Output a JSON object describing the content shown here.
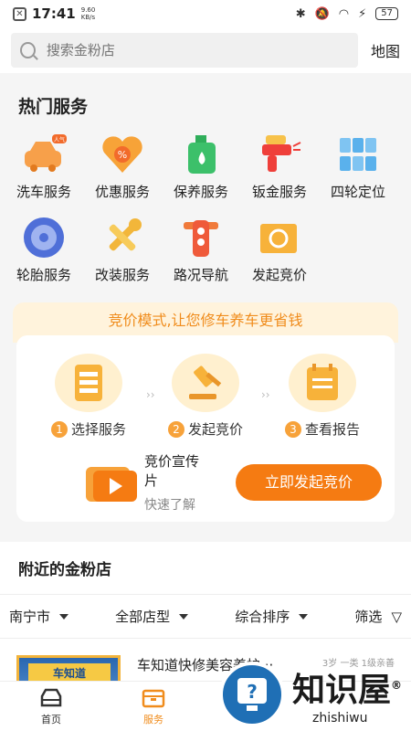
{
  "status_bar": {
    "time": "17:41",
    "net_speed": "9.60",
    "net_unit": "KB/s",
    "battery": "57"
  },
  "search": {
    "placeholder": "搜索金粉店",
    "map_label": "地图"
  },
  "hot_services": {
    "title": "热门服务",
    "items": [
      {
        "label": "洗车服务",
        "icon": "car-wash-icon",
        "badge": "人气"
      },
      {
        "label": "优惠服务",
        "icon": "discount-heart-icon"
      },
      {
        "label": "保养服务",
        "icon": "oil-can-icon"
      },
      {
        "label": "钣金服务",
        "icon": "spray-gun-icon"
      },
      {
        "label": "四轮定位",
        "icon": "grid-blocks-icon"
      },
      {
        "label": "轮胎服务",
        "icon": "tire-icon"
      },
      {
        "label": "改装服务",
        "icon": "wrench-icon"
      },
      {
        "label": "路况导航",
        "icon": "traffic-light-icon"
      },
      {
        "label": "发起竞价",
        "icon": "bid-card-icon"
      }
    ]
  },
  "bid": {
    "banner": "竞价模式,让您修车养车更省钱",
    "steps": [
      {
        "num": "1",
        "label": "选择服务",
        "icon": "menu-list-icon"
      },
      {
        "num": "2",
        "label": "发起竞价",
        "icon": "gavel-icon"
      },
      {
        "num": "3",
        "label": "查看报告",
        "icon": "report-icon"
      }
    ],
    "promo_title": "竞价宣传片",
    "promo_sub": "快速了解",
    "start_button": "立即发起竞价"
  },
  "nearby": {
    "title": "附近的金粉店",
    "filters": [
      "南宁市",
      "全部店型",
      "综合排序",
      "筛选"
    ],
    "shop": {
      "name": "车知道快修美容养护···",
      "meta": "3岁 一类 1级亲善",
      "sign": "车知道"
    }
  },
  "tabbar": [
    {
      "label": "首页",
      "icon": "home-car-icon"
    },
    {
      "label": "服务",
      "icon": "service-box-icon"
    }
  ],
  "watermark": {
    "brand": "知识屋",
    "domain": "zhishiwu",
    "mark": "®"
  },
  "colors": {
    "accent": "#f57b12",
    "banner_bg": "#fff3dc",
    "banner_text": "#f08c1c"
  }
}
